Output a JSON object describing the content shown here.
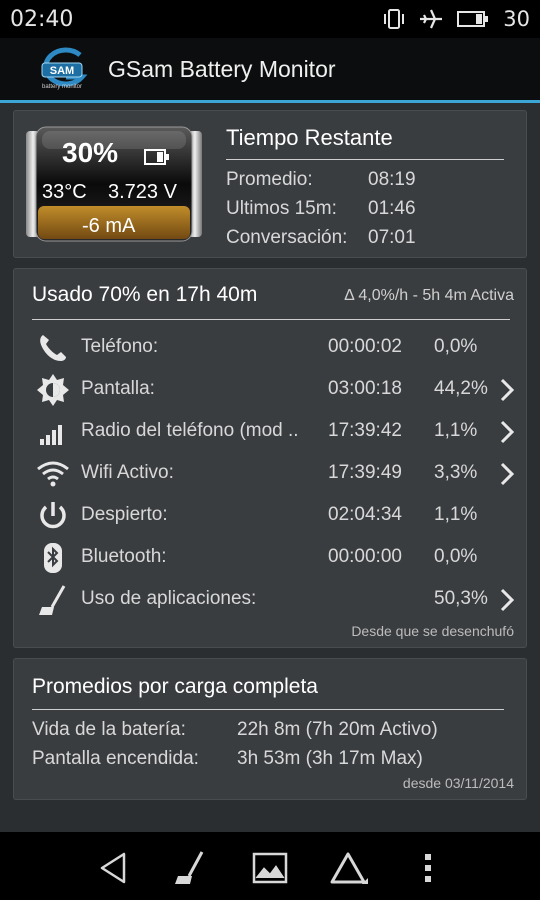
{
  "status_bar": {
    "time": "02:40",
    "battery_text": "30",
    "icons": [
      "vibrate-icon",
      "airplane-icon",
      "battery-icon"
    ]
  },
  "app_bar": {
    "logo_text": "SAM",
    "logo_subtitle": "battery monitor",
    "title": "GSam Battery Monitor"
  },
  "battery_card": {
    "percent": "30%",
    "temperature": "33°C",
    "voltage": "3.723 V",
    "current": "-6 mA",
    "level": 0.3,
    "remaining_title": "Tiempo Restante",
    "rows": [
      {
        "label": "Promedio:",
        "value": "08:19"
      },
      {
        "label": "Ultimos 15m:",
        "value": "01:46"
      },
      {
        "label": "Conversación:",
        "value": "07:01"
      }
    ]
  },
  "usage_card": {
    "title": "Usado 70% en 17h 40m",
    "rate": "Δ 4,0%/h - 5h 4m Activa",
    "rows": [
      {
        "icon": "phone-icon",
        "label": "Teléfono:",
        "duration": "00:00:02",
        "percent": "0,0%",
        "chevron": false
      },
      {
        "icon": "brightness-icon",
        "label": "Pantalla:",
        "duration": "03:00:18",
        "percent": "44,2%",
        "chevron": true
      },
      {
        "icon": "signal-icon",
        "label": "Radio del teléfono (mod ..",
        "duration": "17:39:42",
        "percent": "1,1%",
        "chevron": true
      },
      {
        "icon": "wifi-icon",
        "label": "Wifi Activo:",
        "duration": "17:39:49",
        "percent": "3,3%",
        "chevron": true
      },
      {
        "icon": "power-icon",
        "label": "Despierto:",
        "duration": "02:04:34",
        "percent": "1,1%",
        "chevron": false
      },
      {
        "icon": "bluetooth-icon",
        "label": "Bluetooth:",
        "duration": "00:00:00",
        "percent": "0,0%",
        "chevron": false
      },
      {
        "icon": "broom-icon",
        "label": "Uso de aplicaciones:",
        "duration": "",
        "percent": "50,3%",
        "chevron": true
      }
    ],
    "footnote": "Desde que se desenchufó"
  },
  "averages_card": {
    "title": "Promedios por carga completa",
    "rows": [
      {
        "label": "Vida de la batería:",
        "value": "22h 8m (7h 20m Activo)"
      },
      {
        "label": "Pantalla encendida:",
        "value": "3h 53m (3h 17m Max)"
      }
    ],
    "footnote": "desde 03/11/2014"
  },
  "nav_bar": {
    "buttons": [
      "back-icon",
      "broom-icon",
      "image-icon",
      "delta-icon",
      "overflow-menu-icon"
    ]
  },
  "colors": {
    "accent": "#3ca6d6",
    "card_bg": "#3a3d40",
    "battery_fill": "#b27a1c"
  }
}
